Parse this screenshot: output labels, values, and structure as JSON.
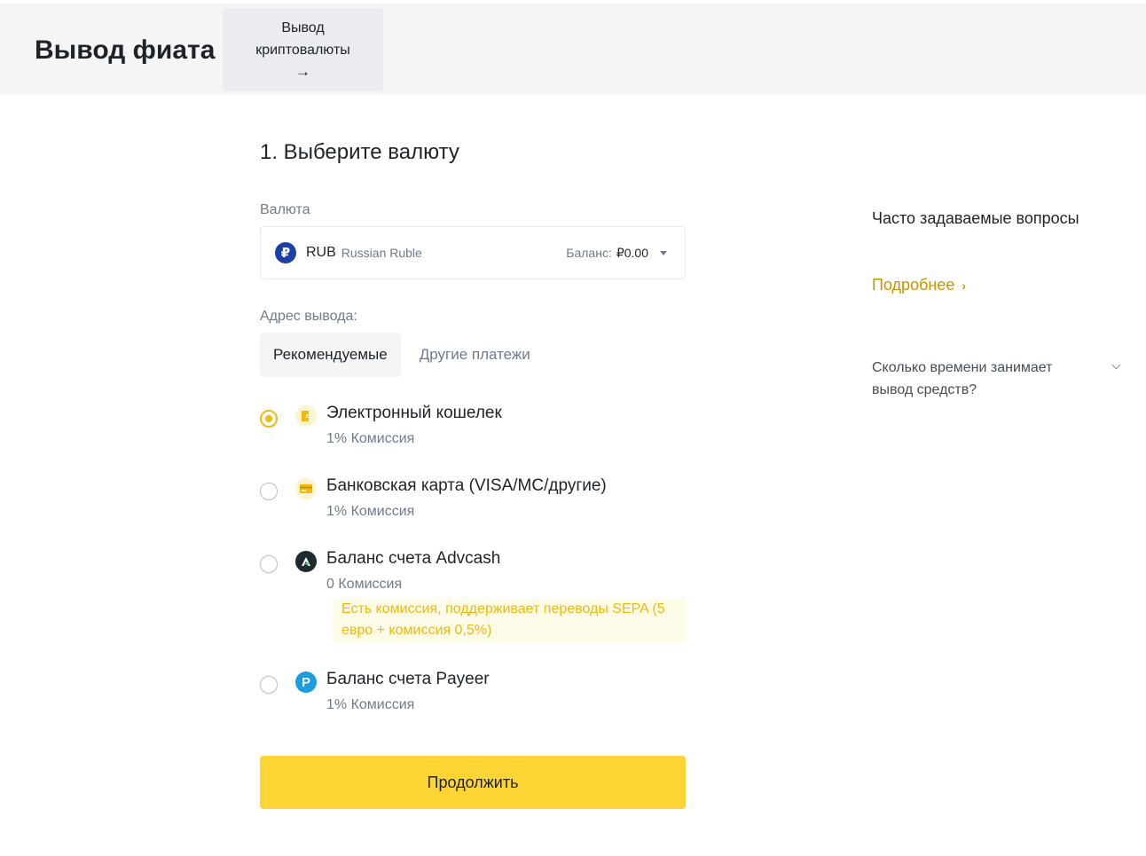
{
  "header": {
    "title": "Вывод фиата",
    "crypto_button": {
      "label": "Вывод криптовалюты",
      "arrow": "→"
    }
  },
  "form": {
    "step_title": "1. Выберите валюту",
    "currency_label": "Валюта",
    "currency": {
      "icon": "ruble-icon",
      "icon_glyph": "₽",
      "code": "RUB",
      "name": "Russian Ruble",
      "balance_label": "Баланс:",
      "balance_value": "₽0.00"
    },
    "address_label": "Адрес вывода:",
    "tabs": [
      {
        "label": "Рекомендуемые",
        "active": true
      },
      {
        "label": "Другие платежи",
        "active": false
      }
    ],
    "options": [
      {
        "title": "Электронный кошелек",
        "fee": "1% Комиссия",
        "icon": "wallet-icon",
        "selected": true
      },
      {
        "title": "Банковская карта (VISA/MC/другие)",
        "fee": "1% Комиссия",
        "icon": "bank-card-icon",
        "selected": false
      },
      {
        "title": "Баланс счета Advcash",
        "fee": "0 Комиссия",
        "icon": "advcash-icon",
        "selected": false,
        "notice": "Есть комиссия, поддерживает переводы SEPA (5 евро + комиссия 0,5%)"
      },
      {
        "title": "Баланс счета Payeer",
        "fee": "1% Комиссия",
        "icon": "payeer-icon",
        "icon_glyph": "P",
        "selected": false
      }
    ],
    "continue_label": "Продолжить"
  },
  "faq": {
    "title": "Часто задаваемые вопросы",
    "more_label": "Подробнее",
    "more_chevron": "›",
    "questions": [
      {
        "text": "Сколько времени занимает вывод средств?"
      }
    ]
  },
  "colors": {
    "accent_yellow": "#fcd535",
    "brand_gold": "#f0b90b",
    "link_gold": "#c99400",
    "ruble_blue": "#1e3fa3",
    "payeer_blue": "#1a9ee0"
  }
}
